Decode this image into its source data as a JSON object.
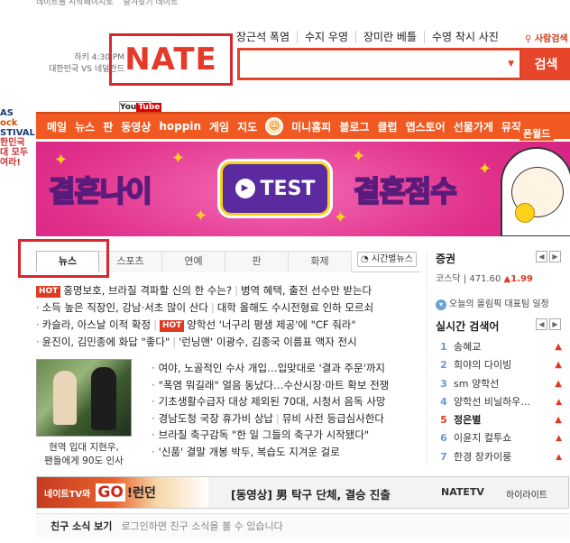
{
  "top_util": [
    "네이트를 시작페이지로",
    "즐겨찾기 네이트"
  ],
  "left_strip": {
    "line1": "AS",
    "line2": "ock",
    "line3": "STIVAL",
    "line4": "한민국",
    "line5": "대 모두",
    "line6": "여라!"
  },
  "weather": {
    "line1": "하키 4:30 PM",
    "line2": "대한민국 VS 네덜란드"
  },
  "logo": "NATE",
  "hot_keywords": [
    "장근석 폭염",
    "수지 우영",
    "장미란 베틀",
    "수영 착시 사진"
  ],
  "signin": "사람검색",
  "search": {
    "value": "",
    "button": "검색"
  },
  "youtube_badge": {
    "you": "You",
    "tube": "Tube"
  },
  "nav": {
    "group1": [
      "메일",
      "뉴스",
      "판",
      "동영상",
      "hoppin",
      "게임",
      "지도"
    ],
    "group2": [
      "미니홈피",
      "블로그",
      "클럽",
      "앱스토어",
      "선물가게",
      "뮤직"
    ],
    "right": "폰월드"
  },
  "banner": {
    "left_a": "결혼",
    "left_b": "나이",
    "test": "TEST",
    "right_a": "결혼",
    "right_b": "점수"
  },
  "tabs": [
    "뉴스",
    "스포츠",
    "연예",
    "판",
    "화제"
  ],
  "time_news": "시간별뉴스",
  "news_rows": [
    {
      "hot": "HOT",
      "a": "홍명보호, 브라질 격파할 신의 한 수는?",
      "b": "병역 혜택, 출전 선수만 받는다"
    },
    {
      "hot": "",
      "a": "소득 높은 직장인, 강남·서초 많이 산다",
      "b": "대학 올해도 수시전형료 인하 모르쇠"
    },
    {
      "hot": "",
      "a": "카슬라, 아스날 이적 확정",
      "hot2": "HOT",
      "b": "양학선 '너구리 평생 제공'에 \"CF 줘라\""
    },
    {
      "hot": "",
      "a": "윤진이, 김민종에 화답 \"좋다\"",
      "b": "'런닝맨' 이광수, 김종국 이름표 액자 전시"
    }
  ],
  "photo_caption": {
    "line1": "현역 입대 지현우,",
    "line2": "팬들에게 90도 인사"
  },
  "right_news": [
    "여야, 노골적인 수사 개입…입맞대로 '결과 주문'까지",
    "\"폭염 뭐길래\" 얼음 동났다…수산시장·마트 확보 전쟁",
    "기초생활수급자 대상 제외된 70대, 시청서 음독 사망",
    "경남도청 국장 휴가비 상납",
    "브라질 축구감독 \"한 일 그들의 축구가 시작됐다\"",
    "'신품' 결말 개봉 박두, 복습도 지겨운 걸로"
  ],
  "right_news_extra": [
    "뮤비 사전 등급심사한다"
  ],
  "stock": {
    "title": "증권",
    "label": "코스닥",
    "value": "471.60",
    "change": "▲1.99"
  },
  "olympic": "오늘의 올림픽 대표팀 일정",
  "realtime": {
    "title": "실시간 검색어",
    "items": [
      {
        "rank": "1",
        "text": "송혜교"
      },
      {
        "rank": "2",
        "text": "희야의 다이빙"
      },
      {
        "rank": "3",
        "text": "sm 양학선"
      },
      {
        "rank": "4",
        "text": "양학선 비닐하우..."
      },
      {
        "rank": "5",
        "text": "정은별"
      },
      {
        "rank": "6",
        "text": "이윤지 컬투쇼"
      },
      {
        "rank": "7",
        "text": "한경 장카이룽"
      }
    ]
  },
  "promo": {
    "tv": "네이트TV와",
    "go": "GO",
    "london": "!런던",
    "headline": "[동영상] 男 탁구 단체, 결승 진출",
    "logo": "NATETV",
    "highlight": "하이라이트"
  },
  "friend": {
    "title": "친구 소식 보기",
    "status": "로그인하면 친구 소식을 볼 수 있습니다"
  },
  "colors": {
    "accent": "#f05a22",
    "red_box": "#d8272e",
    "banner": "#e0308a"
  }
}
